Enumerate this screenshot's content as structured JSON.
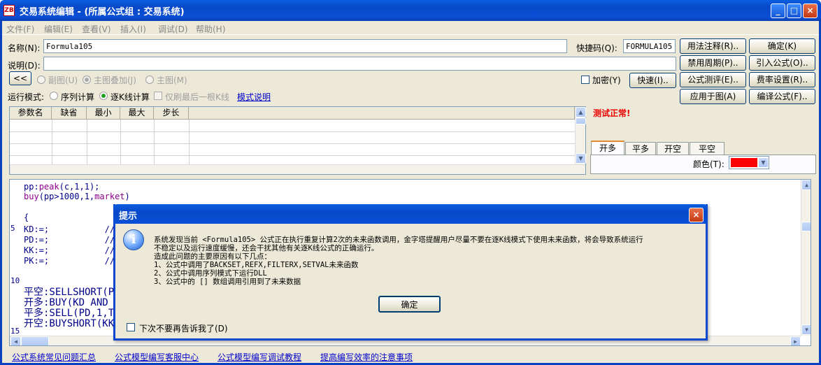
{
  "window": {
    "title": "交易系统编辑 - (所属公式组 : 交易系统)",
    "app_icon_text": "ZB"
  },
  "menu": [
    "文件(F)",
    "编辑(E)",
    "查看(V)",
    "插入(I)",
    "调试(D)",
    "帮助(H)"
  ],
  "form": {
    "name_label": "名称(N):",
    "name_value": "Formula105",
    "shortcut_label": "快捷码(Q):",
    "shortcut_value": "FORMULA105",
    "desc_label": "说明(D):",
    "desc_value": "",
    "collapse_btn": "<<",
    "radio_subchart": "副图(U)",
    "radio_main_overlay": "主图叠加(J)",
    "radio_main": "主图(M)",
    "encrypt_label": "加密(Y)",
    "quick_btn": "快速(I)..",
    "run_mode_label": "运行模式:",
    "mode_seq": "序列计算",
    "mode_kline": "逐K线计算",
    "refresh_last": "仅刷最后一根K线",
    "mode_desc_link": "模式说明"
  },
  "right_buttons": [
    [
      "用法注释(R)..",
      "确定(K)"
    ],
    [
      "禁用周期(P)..",
      "引入公式(O).."
    ],
    [
      "公式测评(E)..",
      "费率设置(R).."
    ],
    [
      "应用于图(A)",
      "编译公式(F).."
    ]
  ],
  "param_table": {
    "headers": [
      "参数名",
      "缺省",
      "最小",
      "最大",
      "步长"
    ],
    "rows": 4
  },
  "test_status": "测试正常!",
  "tabs": [
    "开多",
    "平多",
    "开空",
    "平空"
  ],
  "color_label": "颜色(T):",
  "color_value": "#ff0000",
  "editor": {
    "line1_a": "pp:",
    "line1_fn": "peak",
    "line1_b": "(c,1,1);",
    "line2_fn": "buy",
    "line2_b": "(pp>1000,1,",
    "line2_c": "market",
    "line2_d": ")",
    "line4": "{",
    "line5": "KD:=;           //开",
    "line6": "PD:=;           //平",
    "line7": "KK:=;           //开",
    "line8": "PK:=;           //平",
    "line10": "平空:SELLSHORT(PK,1",
    "line11": "开多:BUY(KD AND HOL",
    "line12": "平多:SELL(PD,1,THIS",
    "line13": "开空:BUYSHORT(KK AN",
    "ln5": "5",
    "ln10": "10",
    "ln15": "15"
  },
  "dialog": {
    "title": "提示",
    "msg1": "系统发现当前 <Formula105> 公式正在执行重复计算2次的未来函数调用，金字塔提醒用户尽量不要在逐K线模式下使用未来函数，将会导致系统运行",
    "msg2": "不稳定以及运行速度缓慢，还会干扰其他有关逐K线公式的正确运行。",
    "msg3": "造成此问题的主要原因有以下几点：",
    "msg4": "1、公式中调用了BACKSET,REFX,FILTERX,SETVAL未来函数",
    "msg5": "2、公式中调用序列模式下运行DLL",
    "msg6": "3、公式中的 [] 数组调用引用到了未来数据",
    "ok_btn": "确定",
    "dont_ask": "下次不要再告诉我了(D)"
  },
  "bottom_links": [
    "公式系统常见问题汇总",
    "公式模型编写客服中心",
    "公式模型编写调试教程",
    "提高编写效率的注意事项"
  ]
}
